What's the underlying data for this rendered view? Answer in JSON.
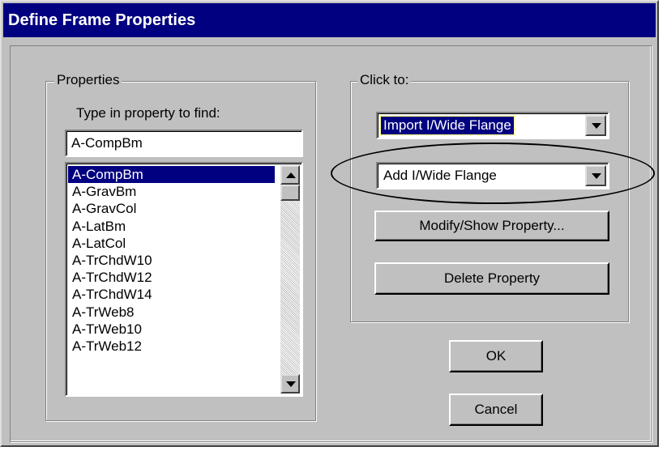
{
  "window": {
    "title": "Define Frame Properties"
  },
  "properties_group": {
    "legend": "Properties",
    "find_label": "Type in property to find:",
    "find_value": "A-CompBm",
    "items": [
      "A-CompBm",
      "A-GravBm",
      "A-GravCol",
      "A-LatBm",
      "A-LatCol",
      "A-TrChdW10",
      "A-TrChdW12",
      "A-TrChdW14",
      "A-TrWeb8",
      "A-TrWeb10",
      "A-TrWeb12"
    ],
    "selected_item": "A-CompBm"
  },
  "click_group": {
    "legend": "Click to:",
    "import_combo": "Import I/Wide Flange",
    "add_combo": "Add I/Wide Flange",
    "modify_button": "Modify/Show Property...",
    "delete_button": "Delete Property"
  },
  "buttons": {
    "ok": "OK",
    "cancel": "Cancel"
  },
  "icons": [
    "scroll-up-arrow-icon",
    "scroll-down-arrow-icon",
    "dropdown-arrow-icon"
  ]
}
